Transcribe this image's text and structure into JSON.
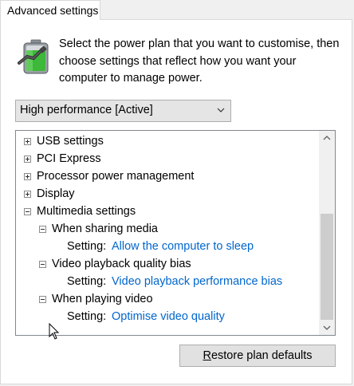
{
  "tab": {
    "label": "Advanced settings"
  },
  "header": {
    "description": "Select the power plan that you want to customise, then choose settings that reflect how you want your computer to manage power.",
    "icon": "battery-plan-icon"
  },
  "plan_select": {
    "selected": "High performance [Active]"
  },
  "tree": {
    "items": [
      {
        "label": "USB settings",
        "expanded": false
      },
      {
        "label": "PCI Express",
        "expanded": false
      },
      {
        "label": "Processor power management",
        "expanded": false
      },
      {
        "label": "Display",
        "expanded": false
      },
      {
        "label": "Multimedia settings",
        "expanded": true
      },
      {
        "label": "When sharing media",
        "expanded": true
      },
      {
        "setting_label": "Setting:",
        "value": "Allow the computer to sleep"
      },
      {
        "label": "Video playback quality bias",
        "expanded": true
      },
      {
        "setting_label": "Setting:",
        "value": "Video playback performance bias"
      },
      {
        "label": "When playing video",
        "expanded": true
      },
      {
        "setting_label": "Setting:",
        "value": "Optimise video quality"
      }
    ]
  },
  "button": {
    "restore_prefix": "R",
    "restore_rest": "estore plan defaults"
  },
  "colors": {
    "link": "#0066cc",
    "panel_bg": "#ffffff",
    "window_bg": "#f0f0f0"
  }
}
